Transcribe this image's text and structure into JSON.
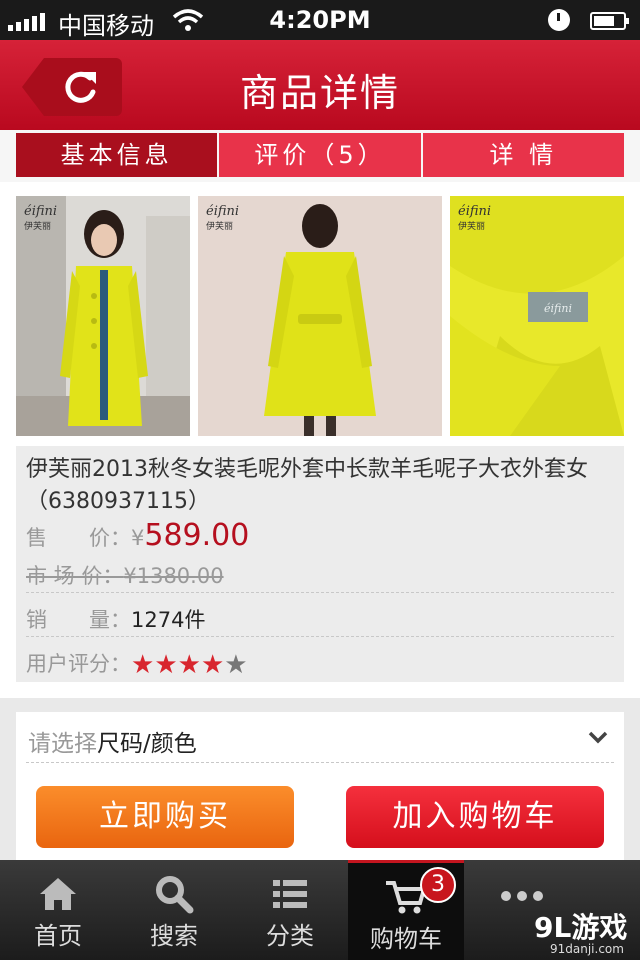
{
  "status_bar": {
    "carrier": "中国移动",
    "time": "4:20PM"
  },
  "header": {
    "title": "商品详情"
  },
  "tabs": [
    {
      "label": "基本信息",
      "active": true
    },
    {
      "label": "评价（5）",
      "active": false
    },
    {
      "label": "详 情",
      "active": false
    }
  ],
  "gallery": {
    "brand_logo": "éifini",
    "brand_logo_cn": "伊芙丽"
  },
  "product": {
    "name": "伊芙丽2013秋冬女装毛呢外套中长款羊毛呢子大衣外套女（6380937115）",
    "price_label": "售　　价：",
    "price_symbol": "¥",
    "price_value": "589.00",
    "market_label": "市 场 价：",
    "market_value": "¥1380.00",
    "sales_label": "销　　量：",
    "sales_value": "1274件",
    "rating_label": "用户评分：",
    "rating": 4,
    "rating_max": 5
  },
  "options": {
    "prompt": "请选择",
    "value": "尺码/颜色",
    "buy_now": "立即购买",
    "add_to_cart": "加入购物车"
  },
  "nav": {
    "home": "首页",
    "search": "搜索",
    "category": "分类",
    "cart": "购物车",
    "cart_count": "3"
  },
  "watermark": {
    "logo": "9L游戏",
    "url": "91danji.com"
  },
  "colors": {
    "brand_red": "#c4151f",
    "price_red": "#b50f1e",
    "buy_orange": "#f07a1d"
  }
}
